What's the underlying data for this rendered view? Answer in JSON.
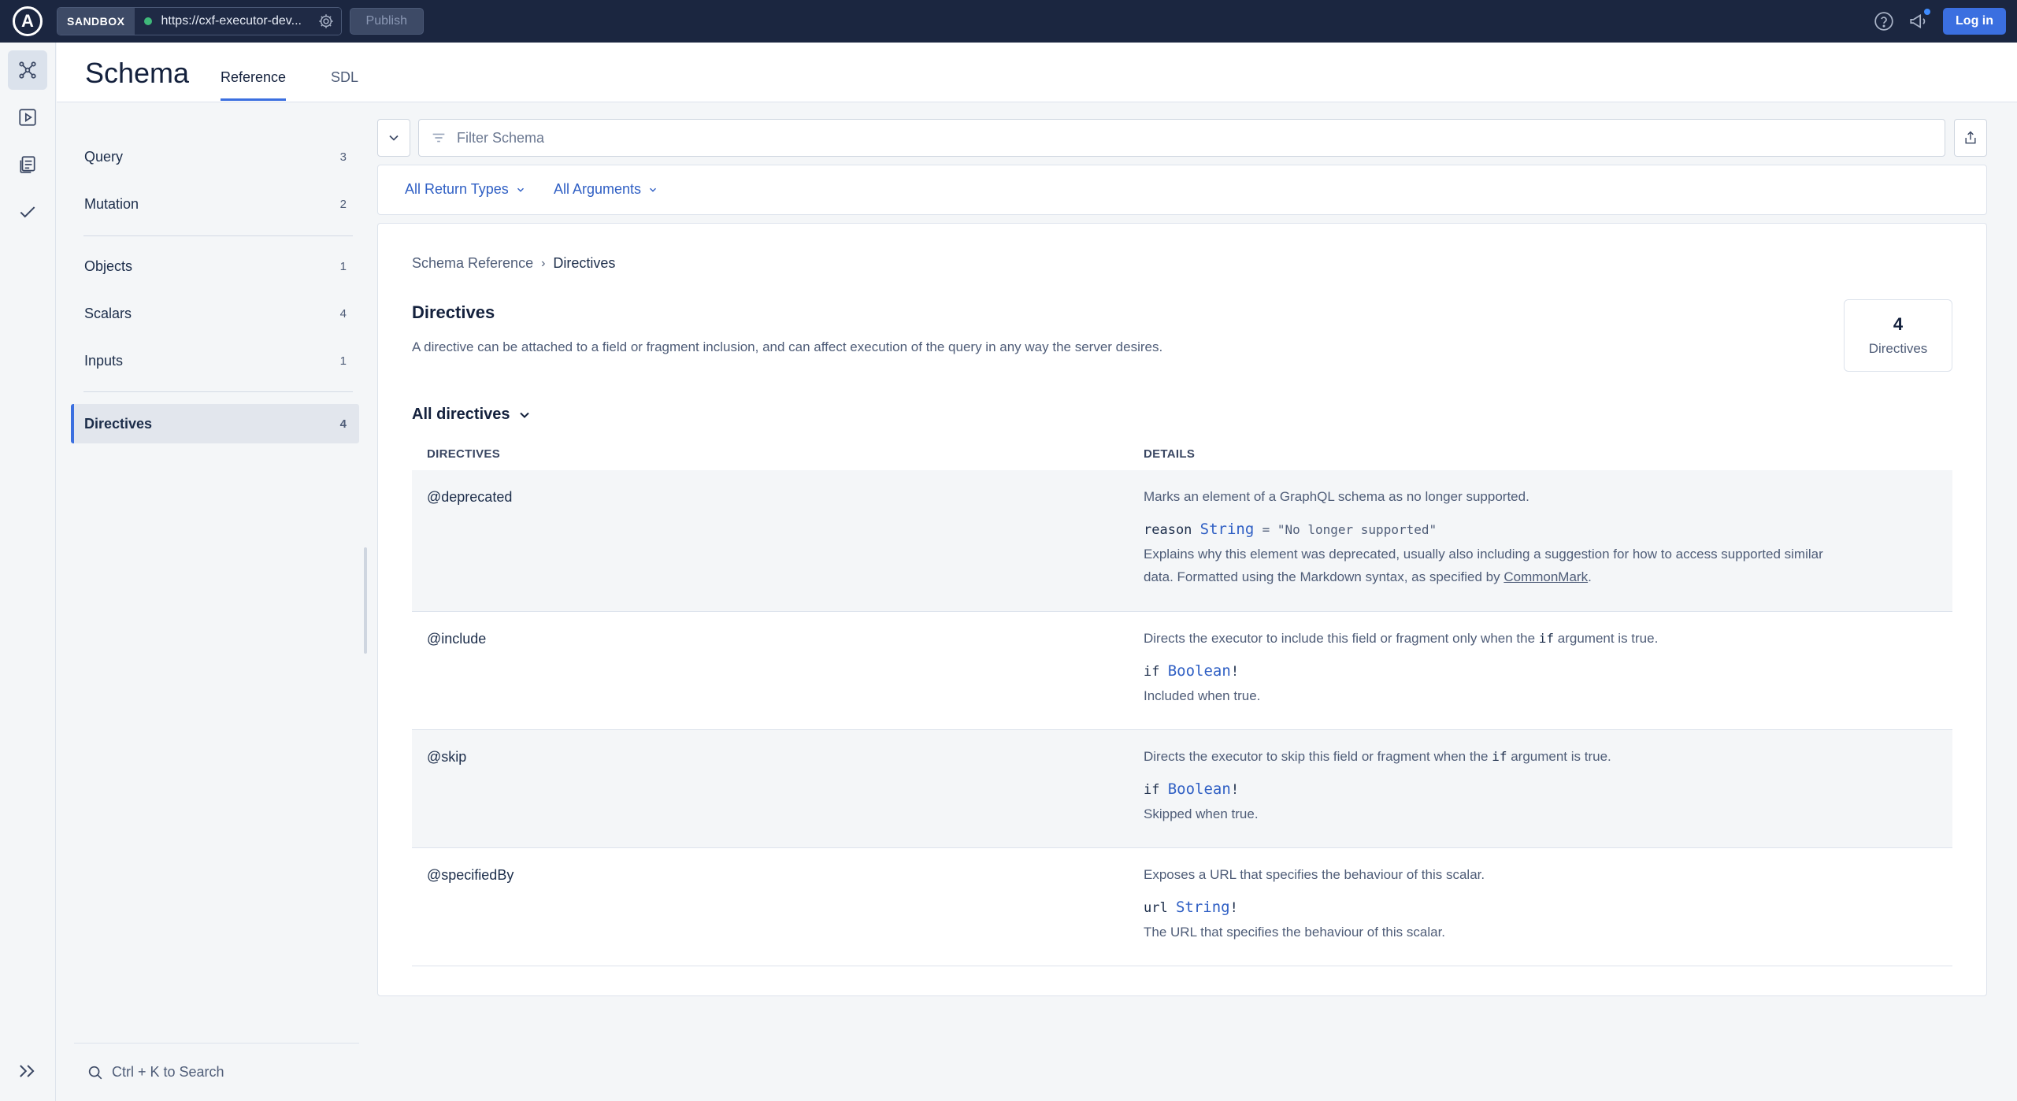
{
  "topbar": {
    "logo": "A",
    "env_tag": "SANDBOX",
    "endpoint_url": "https://cxf-executor-dev...",
    "publish_label": "Publish",
    "login_label": "Log in"
  },
  "header": {
    "title": "Schema",
    "tabs": [
      {
        "label": "Reference",
        "active": true
      },
      {
        "label": "SDL",
        "active": false
      }
    ]
  },
  "sidebar": {
    "items": [
      {
        "label": "Query",
        "count": "3"
      },
      {
        "label": "Mutation",
        "count": "2"
      },
      {
        "label": "Objects",
        "count": "1"
      },
      {
        "label": "Scalars",
        "count": "4"
      },
      {
        "label": "Inputs",
        "count": "1"
      },
      {
        "label": "Directives",
        "count": "4",
        "active": true
      }
    ],
    "search_hint": "Ctrl + K to Search"
  },
  "filter": {
    "placeholder": "Filter Schema",
    "return_types_label": "All Return Types",
    "arguments_label": "All Arguments"
  },
  "main": {
    "breadcrumb": {
      "root": "Schema Reference",
      "current": "Directives"
    },
    "title": "Directives",
    "description": "A directive can be attached to a field or fragment inclusion, and can affect execution of the query in any way the server desires.",
    "stat": {
      "count": "4",
      "label": "Directives"
    },
    "all_directives_label": "All directives",
    "columns": [
      "DIRECTIVES",
      "DETAILS"
    ],
    "rows": [
      {
        "name": "@deprecated",
        "description": "Marks an element of a GraphQL schema as no longer supported.",
        "arg_name": "reason",
        "arg_type": "String",
        "arg_default": "= \"No longer supported\"",
        "arg_desc_before": "Explains why this element was deprecated, usually also including a suggestion for how to access supported similar data. Formatted using the Markdown syntax, as specified by ",
        "arg_desc_link": "CommonMark",
        "arg_desc_after": "."
      },
      {
        "name": "@include",
        "desc_before": "Directs the executor to include this field or fragment only when the ",
        "desc_code": "if",
        "desc_after": " argument is true.",
        "arg_name": "if",
        "arg_type": "Boolean",
        "arg_suffix": "!",
        "arg_desc": "Included when true."
      },
      {
        "name": "@skip",
        "desc_before": "Directs the executor to skip this field or fragment when the ",
        "desc_code": "if",
        "desc_after": " argument is true.",
        "arg_name": "if",
        "arg_type": "Boolean",
        "arg_suffix": "!",
        "arg_desc": "Skipped when true."
      },
      {
        "name": "@specifiedBy",
        "description": "Exposes a URL that specifies the behaviour of this scalar.",
        "arg_name": "url",
        "arg_type": "String",
        "arg_suffix": "!",
        "arg_desc": "The URL that specifies the behaviour of this scalar."
      }
    ]
  },
  "icons": {
    "rail": [
      "schema-icon",
      "explorer-play-icon",
      "docs-icon",
      "checks-icon"
    ],
    "accent_color": "#3b6fe0",
    "topbar_color": "#1b2640",
    "status_dot_color": "#3fb97a"
  }
}
